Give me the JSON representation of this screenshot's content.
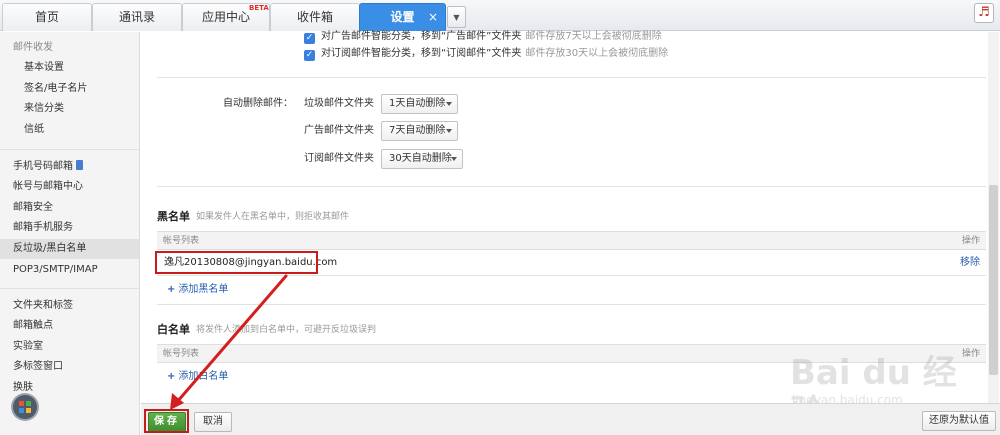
{
  "tabs": [
    {
      "label": "首页"
    },
    {
      "label": "通讯录"
    },
    {
      "label": "应用中心",
      "badge": "BETA"
    },
    {
      "label": "收件箱"
    },
    {
      "label": "设置",
      "close": "×"
    }
  ],
  "sidebar": {
    "group_mail": "邮件收发",
    "items_mail": [
      "基本设置",
      "签名/电子名片",
      "来信分类",
      "信纸"
    ],
    "items_account": [
      "手机号码邮箱",
      "帐号与邮箱中心",
      "邮箱安全",
      "邮箱手机服务",
      "反垃圾/黑白名单",
      "POP3/SMTP/IMAP"
    ],
    "items_misc": [
      "文件夹和标签",
      "邮箱触点",
      "实验室",
      "多标签窗口",
      "换肤"
    ]
  },
  "smart_sort": [
    {
      "text": "对广告邮件智能分类，移到“广告邮件”文件夹",
      "hint": "邮件存放7天以上会被彻底删除"
    },
    {
      "text": "对订阅邮件智能分类，移到“订阅邮件”文件夹",
      "hint": "邮件存放30天以上会被彻底删除"
    }
  ],
  "auto_delete": {
    "label": "自动删除邮件：",
    "rows": [
      {
        "folder": "垃圾邮件文件夹",
        "value": "1天自动删除"
      },
      {
        "folder": "广告邮件文件夹",
        "value": "7天自动删除"
      },
      {
        "folder": "订阅邮件文件夹",
        "value": "30天自动删除"
      }
    ]
  },
  "blacklist": {
    "title": "黑名单",
    "hint": "如果发件人在黑名单中，则拒收其邮件",
    "col_account": "帐号列表",
    "col_action": "操作",
    "entry": "逸凡20130808@jingyan.baidu.com",
    "remove": "移除",
    "add": "添加黑名单"
  },
  "whitelist": {
    "title": "白名单",
    "hint": "将发件人添加到白名单中，可避开反垃圾误判",
    "col_account": "帐号列表",
    "col_action": "操作",
    "add": "添加白名单"
  },
  "footer": {
    "save": "保存",
    "cancel": "取消",
    "restore": "还原为默认值"
  },
  "watermark": {
    "logo": "Bai du 经验",
    "url": "jingyan.baidu.com"
  },
  "colors": {
    "accent": "#3a8ee6",
    "save": "#4a9e38",
    "highlight": "#c81c1c",
    "link": "#2a5db0"
  }
}
